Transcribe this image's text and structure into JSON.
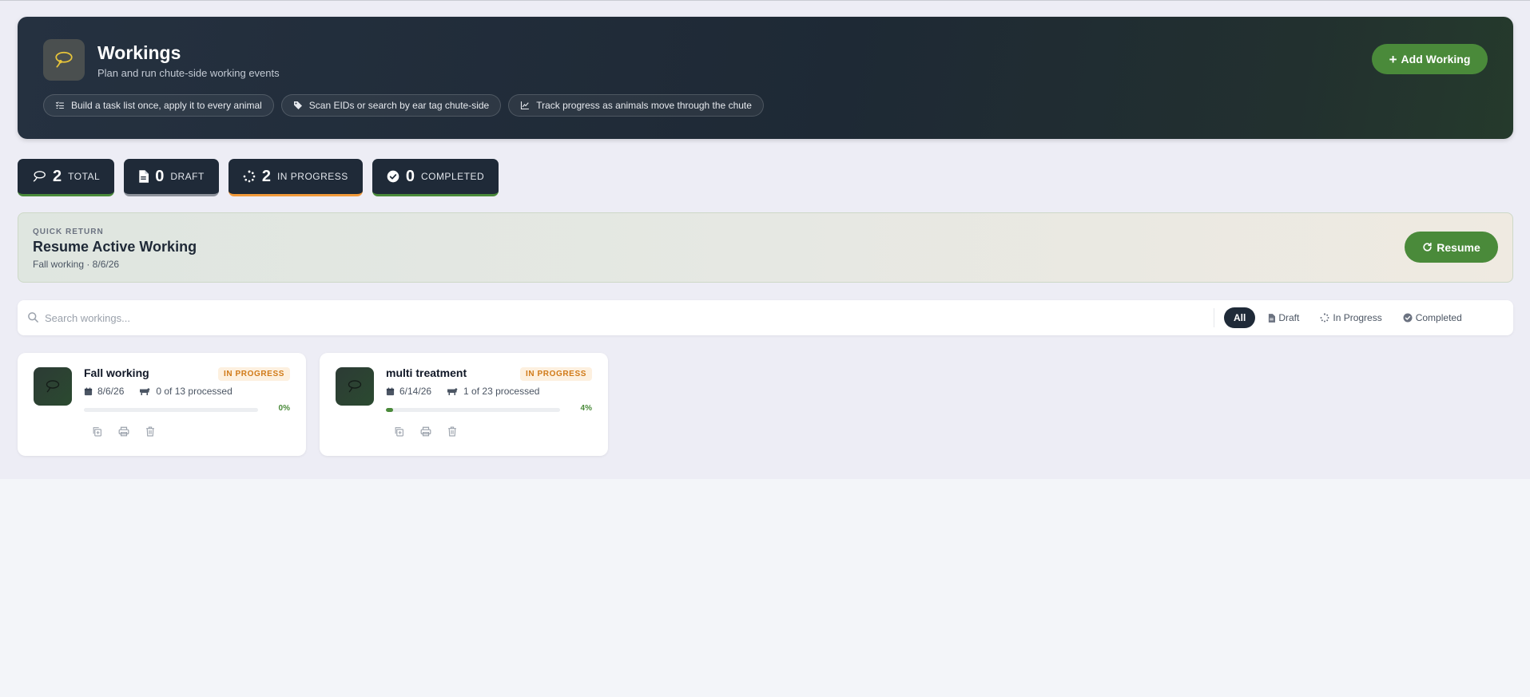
{
  "header": {
    "title": "Workings",
    "subtitle": "Plan and run chute-side working events",
    "add_button_label": "Add Working",
    "chips": [
      {
        "icon": "checklist-icon",
        "label": "Build a task list once, apply it to every animal"
      },
      {
        "icon": "tag-icon",
        "label": "Scan EIDs or search by ear tag chute-side"
      },
      {
        "icon": "chart-line-icon",
        "label": "Track progress as animals move through the chute"
      }
    ]
  },
  "stats": [
    {
      "icon": "lasso-icon",
      "value": "2",
      "label": "TOTAL",
      "accent": "#4a8a3a"
    },
    {
      "icon": "document-icon",
      "value": "0",
      "label": "DRAFT",
      "accent": "#8d929b"
    },
    {
      "icon": "spinner-icon",
      "value": "2",
      "label": "IN PROGRESS",
      "accent": "#f29a3a"
    },
    {
      "icon": "check-circle-icon",
      "value": "0",
      "label": "COMPLETED",
      "accent": "#4a8a3a"
    }
  ],
  "quick_return": {
    "kicker": "QUICK RETURN",
    "title": "Resume Active Working",
    "subtitle": "Fall working · 8/6/26",
    "button_label": "Resume"
  },
  "search": {
    "placeholder": "Search workings...",
    "value": ""
  },
  "filters": [
    {
      "label": "All",
      "icon": "",
      "active": true
    },
    {
      "label": "Draft",
      "icon": "document-icon",
      "active": false
    },
    {
      "label": "In Progress",
      "icon": "spinner-icon",
      "active": false
    },
    {
      "label": "Completed",
      "icon": "check-circle-icon",
      "active": false
    }
  ],
  "workings": [
    {
      "name": "Fall working",
      "status": "IN PROGRESS",
      "date": "8/6/26",
      "processed": "0 of 13 processed",
      "progress": 0,
      "progress_label": "0%"
    },
    {
      "name": "multi treatment",
      "status": "IN PROGRESS",
      "date": "6/14/26",
      "processed": "1 of 23 processed",
      "progress": 0.04,
      "progress_label": "4%"
    }
  ],
  "colors": {
    "accent_green": "#4a8a3a",
    "header_dark": "#1f2a38",
    "badge_orange": "#d07a18",
    "badge_bg": "#fdf0df"
  }
}
